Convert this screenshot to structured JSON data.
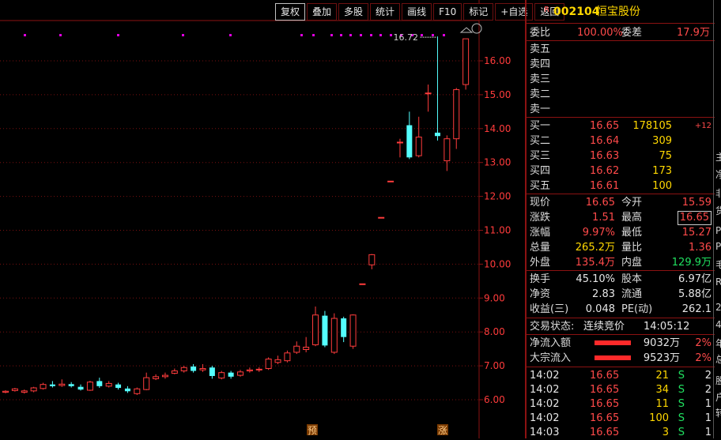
{
  "toolbar": [
    "复权",
    "叠加",
    "多股",
    "统计",
    "画线",
    "F10",
    "标记",
    "+自选",
    "返回"
  ],
  "stock": {
    "flag": "R",
    "code": "002104",
    "name": "恒宝股份"
  },
  "committee": {
    "ratio_label": "委比",
    "ratio": "100.00%",
    "diff_label": "委差",
    "diff": "17.9万"
  },
  "sell_labels": [
    "卖五",
    "卖四",
    "卖三",
    "卖二",
    "卖一"
  ],
  "buy": [
    {
      "label": "买一",
      "price": "16.65",
      "vol": "178105",
      "chg": "+12"
    },
    {
      "label": "买二",
      "price": "16.64",
      "vol": "309",
      "chg": ""
    },
    {
      "label": "买三",
      "price": "16.63",
      "vol": "75",
      "chg": ""
    },
    {
      "label": "买四",
      "price": "16.62",
      "vol": "173",
      "chg": ""
    },
    {
      "label": "买五",
      "price": "16.61",
      "vol": "100",
      "chg": ""
    }
  ],
  "quote": [
    {
      "l1": "现价",
      "v1": "16.65",
      "l2": "今开",
      "v2": "15.59",
      "c2": "red"
    },
    {
      "l1": "涨跌",
      "v1": "1.51",
      "l2": "最高",
      "v2": "16.65",
      "c2": "red",
      "box": true
    },
    {
      "l1": "涨幅",
      "v1": "9.97%",
      "l2": "最低",
      "v2": "15.27",
      "c2": "red"
    },
    {
      "l1": "总量",
      "v1": "265.2万",
      "l2": "量比",
      "v2": "1.36",
      "c1": "yel",
      "c2": "red"
    },
    {
      "l1": "外盘",
      "v1": "135.4万",
      "l2": "内盘",
      "v2": "129.9万",
      "c1": "red",
      "c2": "grn"
    }
  ],
  "fundamentals": [
    {
      "l1": "换手",
      "v1": "45.10%",
      "l2": "股本",
      "v2": "6.97亿"
    },
    {
      "l1": "净资",
      "v1": "2.83",
      "l2": "流通",
      "v2": "5.88亿"
    },
    {
      "l1": "收益(三)",
      "v1": "0.048",
      "l2": "PE(动)",
      "v2": "262.1"
    }
  ],
  "trade_status": {
    "label": "交易状态:",
    "value": "连续竞价",
    "time": "14:05:12"
  },
  "flows": [
    {
      "label": "净流入额",
      "value": "9032万",
      "pct": "2%"
    },
    {
      "label": "大宗流入",
      "value": "9523万",
      "pct": "2%"
    }
  ],
  "ticks": [
    {
      "time": "14:02",
      "price": "16.65",
      "vol": "21",
      "side": "S",
      "n": "2"
    },
    {
      "time": "14:02",
      "price": "16.65",
      "vol": "34",
      "side": "S",
      "n": "2"
    },
    {
      "time": "14:02",
      "price": "16.65",
      "vol": "11",
      "side": "S",
      "n": "1"
    },
    {
      "time": "14:02",
      "price": "16.65",
      "vol": "100",
      "side": "S",
      "n": "1"
    },
    {
      "time": "14:03",
      "price": "16.65",
      "vol": "3",
      "side": "S",
      "n": "1"
    }
  ],
  "far_edge": [
    "主",
    "净",
    "非",
    "货",
    "P",
    "P",
    "毛",
    "R",
    "2",
    "4",
    "年",
    "总",
    "股",
    "户",
    "转"
  ],
  "chart_data": {
    "type": "candlestick",
    "ylim": [
      5.8,
      17.0
    ],
    "yticks": [
      "16.00",
      "15.00",
      "14.00",
      "13.00",
      "12.00",
      "11.00",
      "10.00",
      "9.00",
      "8.00",
      "7.00",
      "6.00"
    ],
    "annotation": "16.72",
    "bottom_marks": [
      "预",
      "涨"
    ],
    "candles": [
      {
        "o": 6.22,
        "c": 6.25,
        "h": 6.28,
        "l": 6.19
      },
      {
        "o": 6.27,
        "c": 6.32,
        "h": 6.35,
        "l": 6.24
      },
      {
        "o": 6.22,
        "c": 6.26,
        "h": 6.3,
        "l": 6.18
      },
      {
        "o": 6.26,
        "c": 6.35,
        "h": 6.38,
        "l": 6.22
      },
      {
        "o": 6.33,
        "c": 6.45,
        "h": 6.5,
        "l": 6.3
      },
      {
        "o": 6.45,
        "c": 6.4,
        "h": 6.55,
        "l": 6.36
      },
      {
        "o": 6.42,
        "c": 6.46,
        "h": 6.6,
        "l": 6.38
      },
      {
        "o": 6.46,
        "c": 6.4,
        "h": 6.52,
        "l": 6.36
      },
      {
        "o": 6.38,
        "c": 6.3,
        "h": 6.45,
        "l": 6.27
      },
      {
        "o": 6.28,
        "c": 6.52,
        "h": 6.56,
        "l": 6.26
      },
      {
        "o": 6.55,
        "c": 6.4,
        "h": 6.65,
        "l": 6.35
      },
      {
        "o": 6.4,
        "c": 6.48,
        "h": 6.55,
        "l": 6.36
      },
      {
        "o": 6.45,
        "c": 6.35,
        "h": 6.5,
        "l": 6.3
      },
      {
        "o": 6.33,
        "c": 6.25,
        "h": 6.4,
        "l": 6.2
      },
      {
        "o": 6.18,
        "c": 6.32,
        "h": 6.36,
        "l": 6.14
      },
      {
        "o": 6.3,
        "c": 6.65,
        "h": 6.8,
        "l": 6.28
      },
      {
        "o": 6.62,
        "c": 6.68,
        "h": 6.75,
        "l": 6.58
      },
      {
        "o": 6.68,
        "c": 6.72,
        "h": 6.8,
        "l": 6.62
      },
      {
        "o": 6.78,
        "c": 6.85,
        "h": 6.92,
        "l": 6.75
      },
      {
        "o": 6.85,
        "c": 6.95,
        "h": 7.0,
        "l": 6.8
      },
      {
        "o": 6.98,
        "c": 6.85,
        "h": 7.05,
        "l": 6.8
      },
      {
        "o": 6.88,
        "c": 6.92,
        "h": 7.05,
        "l": 6.82
      },
      {
        "o": 6.95,
        "c": 6.7,
        "h": 7.0,
        "l": 6.62
      },
      {
        "o": 6.64,
        "c": 6.8,
        "h": 6.85,
        "l": 6.6
      },
      {
        "o": 6.8,
        "c": 6.68,
        "h": 6.85,
        "l": 6.62
      },
      {
        "o": 6.72,
        "c": 6.82,
        "h": 6.88,
        "l": 6.68
      },
      {
        "o": 6.85,
        "c": 6.88,
        "h": 6.95,
        "l": 6.8
      },
      {
        "o": 6.88,
        "c": 6.9,
        "h": 6.96,
        "l": 6.82
      },
      {
        "o": 6.92,
        "c": 7.2,
        "h": 7.25,
        "l": 6.88
      },
      {
        "o": 7.1,
        "c": 7.18,
        "h": 7.3,
        "l": 7.05
      },
      {
        "o": 7.15,
        "c": 7.38,
        "h": 7.45,
        "l": 7.1
      },
      {
        "o": 7.4,
        "c": 7.58,
        "h": 7.72,
        "l": 7.35
      },
      {
        "o": 7.48,
        "c": 7.55,
        "h": 7.85,
        "l": 7.4
      },
      {
        "o": 7.62,
        "c": 8.5,
        "h": 8.75,
        "l": 7.58
      },
      {
        "o": 8.48,
        "c": 7.6,
        "h": 8.62,
        "l": 7.55
      },
      {
        "o": 7.4,
        "c": 8.4,
        "h": 8.55,
        "l": 7.35
      },
      {
        "o": 8.4,
        "c": 7.85,
        "h": 8.45,
        "l": 7.7
      },
      {
        "o": 7.58,
        "c": 8.5,
        "h": 8.52,
        "l": 7.5
      },
      {
        "o": 9.42,
        "c": 9.42,
        "h": 9.42,
        "l": 9.42
      },
      {
        "o": 9.98,
        "c": 10.28,
        "h": 10.3,
        "l": 9.85
      },
      {
        "o": 11.38,
        "c": 11.38,
        "h": 11.38,
        "l": 11.38
      },
      {
        "o": 12.45,
        "c": 12.45,
        "h": 12.45,
        "l": 12.45
      },
      {
        "o": 13.6,
        "c": 13.6,
        "h": 13.7,
        "l": 13.15
      },
      {
        "o": 14.1,
        "c": 13.15,
        "h": 14.5,
        "l": 13.1
      },
      {
        "o": 13.2,
        "c": 13.75,
        "h": 14.35,
        "l": 13.15
      },
      {
        "o": 15.05,
        "c": 15.05,
        "h": 15.3,
        "l": 14.5
      },
      {
        "o": 13.88,
        "c": 13.78,
        "h": 16.72,
        "l": 13.65
      },
      {
        "o": 13.05,
        "c": 13.7,
        "h": 13.8,
        "l": 12.75
      },
      {
        "o": 13.7,
        "c": 15.15,
        "h": 15.2,
        "l": 13.4
      },
      {
        "o": 15.3,
        "c": 16.65,
        "h": 16.65,
        "l": 15.15
      }
    ]
  }
}
